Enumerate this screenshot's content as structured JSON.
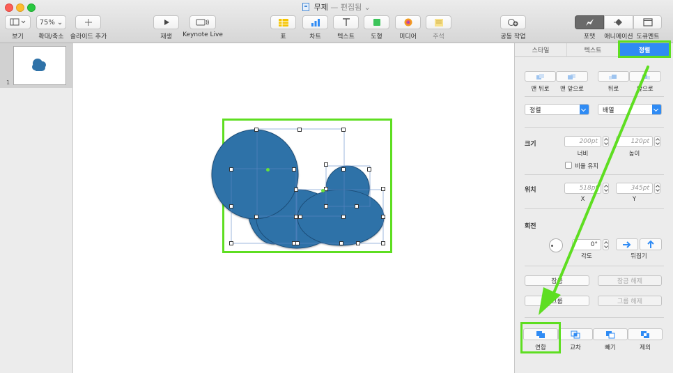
{
  "window": {
    "title": "무제",
    "edited": "— 편집됨 ⌄"
  },
  "toolbar": {
    "view_label": "보기",
    "zoom_value": "75%",
    "zoom_label": "확대/축소",
    "add_slide_label": "슬라이드 추가",
    "play_label": "재생",
    "keynote_live_label": "Keynote Live",
    "table_label": "표",
    "chart_label": "차트",
    "text_label": "텍스트",
    "shape_label": "도형",
    "media_label": "미디어",
    "comment_label": "주석",
    "collaborate_label": "공동 작업",
    "format_label": "포맷",
    "animate_label": "애니메이션",
    "document_label": "도큐멘트"
  },
  "navigator": {
    "slide_number": "1"
  },
  "inspector": {
    "tabs": [
      "스타일",
      "텍스트",
      "정렬"
    ],
    "active_tab": "정렬",
    "order": {
      "to_back": "맨 뒤로",
      "to_front": "맨 앞으로",
      "backward": "뒤로",
      "forward": "앞으로"
    },
    "align_select": "정렬",
    "distribute_select": "배열",
    "size": {
      "heading": "크기",
      "width": "200pt",
      "height": "120pt",
      "width_label": "너비",
      "height_label": "높이",
      "constrain_label": "비율 유지"
    },
    "position": {
      "heading": "위치",
      "x": "518pt",
      "y": "345pt",
      "x_label": "X",
      "y_label": "Y"
    },
    "rotate": {
      "heading": "회전",
      "angle": "0°",
      "angle_label": "각도",
      "flip_label": "뒤집기"
    },
    "lock": "잠금",
    "unlock": "잠금 해제",
    "group": "그룹",
    "ungroup": "그룹 해제",
    "combine": {
      "union": "연합",
      "intersect": "교차",
      "subtract": "빼기",
      "exclude": "제외"
    }
  },
  "colors": {
    "shape_fill": "#2f72a8",
    "highlight": "#5ede21",
    "accent": "#2f8bf4"
  }
}
